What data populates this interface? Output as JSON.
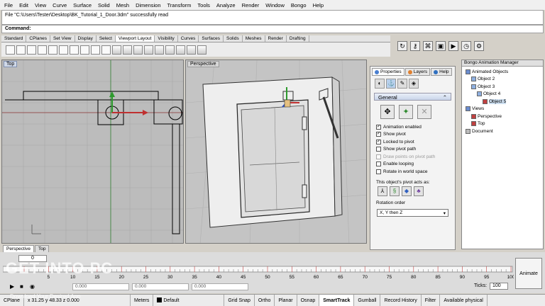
{
  "menu": [
    "File",
    "Edit",
    "View",
    "Curve",
    "Surface",
    "Solid",
    "Mesh",
    "Dimension",
    "Transform",
    "Tools",
    "Analyze",
    "Render",
    "Window",
    "Bongo",
    "Help"
  ],
  "history_text": "File \"C:\\Users\\Tester\\Desktop\\BK_Tutorial_1_Door.3dm\" successfully read",
  "command_label": "Command:",
  "toolbar_tabs": [
    "Standard",
    "CPlanes",
    "Set View",
    "Display",
    "Select",
    "Viewport Layout",
    "Visibility",
    "Curves",
    "Surfaces",
    "Solids",
    "Meshes",
    "Render",
    "Drafting"
  ],
  "active_toolbar_tab": "Viewport Layout",
  "viewports": {
    "top_label": "Top",
    "persp_label": "Perspective"
  },
  "viewport_tabs": [
    "Perspective",
    "Top"
  ],
  "panel": {
    "tabs": [
      "Properties",
      "Layers",
      "Help"
    ],
    "section": "General",
    "options": [
      {
        "label": "Animation enabled",
        "checked": true,
        "disabled": false
      },
      {
        "label": "Show pivot",
        "checked": true,
        "disabled": false
      },
      {
        "label": "Locked to pivot",
        "checked": true,
        "disabled": false
      },
      {
        "label": "Show pivot path",
        "checked": false,
        "disabled": false
      },
      {
        "label": "Draw points on pivot path",
        "checked": false,
        "disabled": true
      },
      {
        "label": "Enable looping",
        "checked": false,
        "disabled": false
      },
      {
        "label": "Rotate in world space",
        "checked": false,
        "disabled": false
      }
    ],
    "pivot_label": "This object's pivot acts as:",
    "rotation_label": "Rotation order",
    "rotation_value": "X, Y then Z"
  },
  "bongo": {
    "title": "Bongo Animation Manager",
    "tree": [
      {
        "label": "Animated Objects",
        "level": 0
      },
      {
        "label": "Object 2",
        "level": 1
      },
      {
        "label": "Object 3",
        "level": 1
      },
      {
        "label": "Object 4",
        "level": 2
      },
      {
        "label": "Object 5",
        "level": 3
      },
      {
        "label": "Views",
        "level": 0
      },
      {
        "label": "Perspective",
        "level": 1
      },
      {
        "label": "Top",
        "level": 1
      },
      {
        "label": "Document",
        "level": 0
      }
    ]
  },
  "timeline": {
    "current_frame": "0",
    "ruler_labels": [
      "5",
      "10",
      "15",
      "20",
      "25",
      "30",
      "35",
      "40",
      "45",
      "50",
      "55",
      "60",
      "65",
      "70",
      "75",
      "80",
      "85",
      "90",
      "95",
      "100"
    ],
    "ticks_label": "Ticks:",
    "ticks_value": "100",
    "animate_label": "Animate",
    "key_value_a": "0.000",
    "key_value_b": "0.000",
    "key_value_c": "0.000"
  },
  "status": {
    "cplane": "CPlane",
    "coords": "x 31.25   y 48.33   z 0.000",
    "units": "Meters",
    "layer": "Default",
    "toggles": [
      "Grid Snap",
      "Ortho",
      "Planar",
      "Osnap",
      "SmartTrack",
      "Gumball",
      "Record History",
      "Filter"
    ],
    "active_toggle": "SmartTrack",
    "memory": "Available physical"
  },
  "watermark": {
    "main": "GET INTO PC",
    "sub": "Download Your Desired App"
  }
}
